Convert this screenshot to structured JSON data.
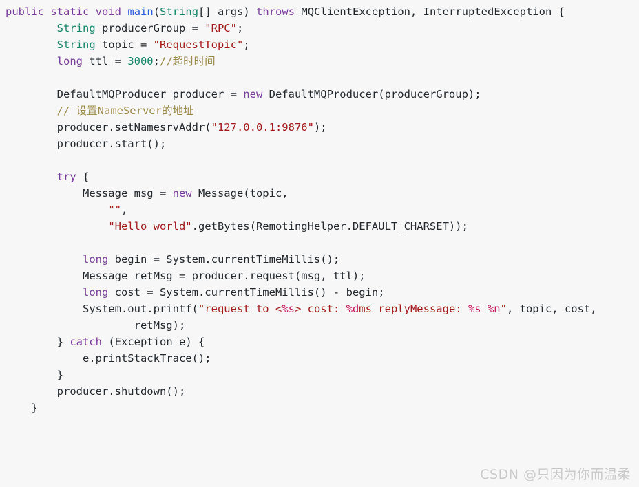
{
  "editor": {
    "language": "java",
    "background_color": "#f7f7f7",
    "foreground_color": "#24292e",
    "font_size_px": 15.5,
    "line_height_px": 24,
    "theme_colors": {
      "keyword": "#7a3e9d",
      "type": "#17866a",
      "method": "#2b5fd9",
      "string": "#a31c1c",
      "format_specifier": "#c2185b",
      "comment": "#9b8b4a",
      "number": "#17866a",
      "plain": "#24292e"
    }
  },
  "code": {
    "lines": [
      {
        "number": 1,
        "text": "public static void main(String[] args) throws MQClientException, InterruptedException {",
        "tokens": [
          {
            "t": "public",
            "c": "keyword"
          },
          {
            "t": " ",
            "c": "plain"
          },
          {
            "t": "static",
            "c": "keyword"
          },
          {
            "t": " ",
            "c": "plain"
          },
          {
            "t": "void",
            "c": "keyword"
          },
          {
            "t": " ",
            "c": "plain"
          },
          {
            "t": "main",
            "c": "method"
          },
          {
            "t": "(",
            "c": "plain"
          },
          {
            "t": "String",
            "c": "type"
          },
          {
            "t": "[] args) ",
            "c": "plain"
          },
          {
            "t": "throws",
            "c": "keyword"
          },
          {
            "t": " MQClientException, InterruptedException {",
            "c": "plain"
          }
        ]
      },
      {
        "number": 2,
        "text": "        String producerGroup = \"RPC\";",
        "tokens": [
          {
            "t": "        ",
            "c": "plain"
          },
          {
            "t": "String",
            "c": "type"
          },
          {
            "t": " producerGroup = ",
            "c": "plain"
          },
          {
            "t": "\"RPC\"",
            "c": "string"
          },
          {
            "t": ";",
            "c": "plain"
          }
        ]
      },
      {
        "number": 3,
        "text": "        String topic = \"RequestTopic\";",
        "tokens": [
          {
            "t": "        ",
            "c": "plain"
          },
          {
            "t": "String",
            "c": "type"
          },
          {
            "t": " topic = ",
            "c": "plain"
          },
          {
            "t": "\"RequestTopic\"",
            "c": "string"
          },
          {
            "t": ";",
            "c": "plain"
          }
        ]
      },
      {
        "number": 4,
        "text": "        long ttl = 3000;//超时时间",
        "tokens": [
          {
            "t": "        ",
            "c": "plain"
          },
          {
            "t": "long",
            "c": "keyword"
          },
          {
            "t": " ttl = ",
            "c": "plain"
          },
          {
            "t": "3000",
            "c": "number"
          },
          {
            "t": ";",
            "c": "plain"
          },
          {
            "t": "//超时时间",
            "c": "comment"
          }
        ]
      },
      {
        "number": 5,
        "text": "",
        "tokens": []
      },
      {
        "number": 6,
        "text": "        DefaultMQProducer producer = new DefaultMQProducer(producerGroup);",
        "tokens": [
          {
            "t": "        DefaultMQProducer producer = ",
            "c": "plain"
          },
          {
            "t": "new",
            "c": "keyword"
          },
          {
            "t": " DefaultMQProducer(producerGroup);",
            "c": "plain"
          }
        ]
      },
      {
        "number": 7,
        "text": "        // 设置NameServer的地址",
        "tokens": [
          {
            "t": "        ",
            "c": "plain"
          },
          {
            "t": "// 设置NameServer的地址",
            "c": "comment"
          }
        ]
      },
      {
        "number": 8,
        "text": "        producer.setNamesrvAddr(\"127.0.0.1:9876\");",
        "tokens": [
          {
            "t": "        producer.setNamesrvAddr(",
            "c": "plain"
          },
          {
            "t": "\"127.0.0.1:9876\"",
            "c": "string"
          },
          {
            "t": ");",
            "c": "plain"
          }
        ]
      },
      {
        "number": 9,
        "text": "        producer.start();",
        "tokens": [
          {
            "t": "        producer.start();",
            "c": "plain"
          }
        ]
      },
      {
        "number": 10,
        "text": "",
        "tokens": []
      },
      {
        "number": 11,
        "text": "        try {",
        "tokens": [
          {
            "t": "        ",
            "c": "plain"
          },
          {
            "t": "try",
            "c": "keyword"
          },
          {
            "t": " {",
            "c": "plain"
          }
        ]
      },
      {
        "number": 12,
        "text": "            Message msg = new Message(topic,",
        "tokens": [
          {
            "t": "            Message msg = ",
            "c": "plain"
          },
          {
            "t": "new",
            "c": "keyword"
          },
          {
            "t": " Message(topic,",
            "c": "plain"
          }
        ]
      },
      {
        "number": 13,
        "text": "                \"\",",
        "tokens": [
          {
            "t": "                ",
            "c": "plain"
          },
          {
            "t": "\"\"",
            "c": "string"
          },
          {
            "t": ",",
            "c": "plain"
          }
        ]
      },
      {
        "number": 14,
        "text": "                \"Hello world\".getBytes(RemotingHelper.DEFAULT_CHARSET));",
        "tokens": [
          {
            "t": "                ",
            "c": "plain"
          },
          {
            "t": "\"Hello world\"",
            "c": "string"
          },
          {
            "t": ".getBytes(RemotingHelper.DEFAULT_CHARSET));",
            "c": "plain"
          }
        ]
      },
      {
        "number": 15,
        "text": "",
        "tokens": []
      },
      {
        "number": 16,
        "text": "            long begin = System.currentTimeMillis();",
        "tokens": [
          {
            "t": "            ",
            "c": "plain"
          },
          {
            "t": "long",
            "c": "keyword"
          },
          {
            "t": " begin = System.currentTimeMillis();",
            "c": "plain"
          }
        ]
      },
      {
        "number": 17,
        "text": "            Message retMsg = producer.request(msg, ttl);",
        "tokens": [
          {
            "t": "            Message retMsg = producer.request(msg, ttl);",
            "c": "plain"
          }
        ]
      },
      {
        "number": 18,
        "text": "            long cost = System.currentTimeMillis() - begin;",
        "tokens": [
          {
            "t": "            ",
            "c": "plain"
          },
          {
            "t": "long",
            "c": "keyword"
          },
          {
            "t": " cost = System.currentTimeMillis() - begin;",
            "c": "plain"
          }
        ]
      },
      {
        "number": 19,
        "text": "            System.out.printf(\"request to <%s> cost: %dms replyMessage: %s %n\", topic, cost,",
        "tokens": [
          {
            "t": "            System.out.printf(",
            "c": "plain"
          },
          {
            "t": "\"request to <",
            "c": "string"
          },
          {
            "t": "%s",
            "c": "format_specifier"
          },
          {
            "t": "> cost: ",
            "c": "string"
          },
          {
            "t": "%d",
            "c": "format_specifier"
          },
          {
            "t": "ms replyMessage: ",
            "c": "string"
          },
          {
            "t": "%s",
            "c": "format_specifier"
          },
          {
            "t": " ",
            "c": "string"
          },
          {
            "t": "%n",
            "c": "format_specifier"
          },
          {
            "t": "\"",
            "c": "string"
          },
          {
            "t": ", topic, cost,",
            "c": "plain"
          }
        ]
      },
      {
        "number": 20,
        "text": "                    retMsg);",
        "tokens": [
          {
            "t": "                    retMsg);",
            "c": "plain"
          }
        ]
      },
      {
        "number": 21,
        "text": "        } catch (Exception e) {",
        "tokens": [
          {
            "t": "        } ",
            "c": "plain"
          },
          {
            "t": "catch",
            "c": "keyword"
          },
          {
            "t": " (Exception e) {",
            "c": "plain"
          }
        ]
      },
      {
        "number": 22,
        "text": "            e.printStackTrace();",
        "tokens": [
          {
            "t": "            e.printStackTrace();",
            "c": "plain"
          }
        ]
      },
      {
        "number": 23,
        "text": "        }",
        "tokens": [
          {
            "t": "        }",
            "c": "plain"
          }
        ]
      },
      {
        "number": 24,
        "text": "        producer.shutdown();",
        "tokens": [
          {
            "t": "        producer.shutdown();",
            "c": "plain"
          }
        ]
      },
      {
        "number": 25,
        "text": "    }",
        "tokens": [
          {
            "t": "    }",
            "c": "plain"
          }
        ]
      }
    ]
  },
  "watermark": {
    "text": "CSDN @只因为你而温柔",
    "color": "#c9c9c9"
  }
}
